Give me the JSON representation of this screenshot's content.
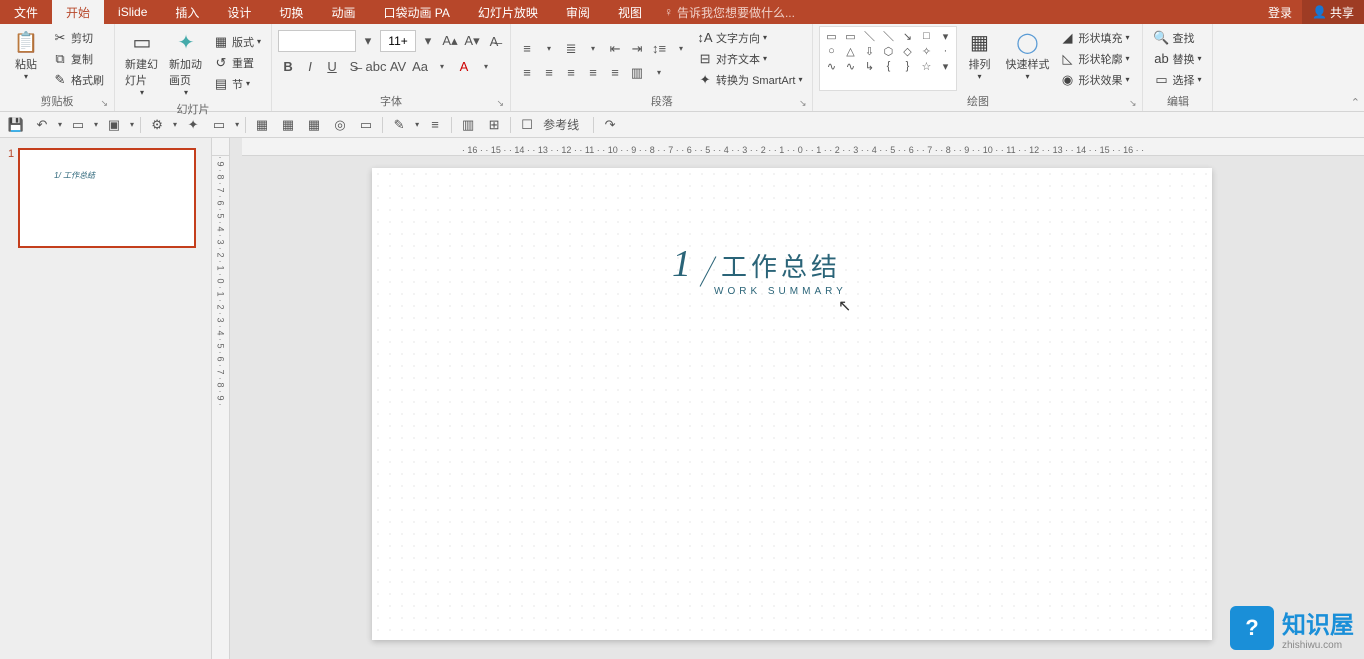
{
  "menu": {
    "file": "文件",
    "tabs": [
      "开始",
      "iSlide",
      "插入",
      "设计",
      "切换",
      "动画",
      "口袋动画 PA",
      "幻灯片放映",
      "审阅",
      "视图"
    ],
    "active": "开始",
    "tell_me_icon": "lightbulb-icon",
    "tell_me": "告诉我您想要做什么...",
    "login": "登录",
    "share": "共享"
  },
  "ribbon": {
    "clipboard": {
      "label": "剪贴板",
      "paste": "粘贴",
      "cut": "剪切",
      "copy": "复制",
      "format_painter": "格式刷"
    },
    "slides": {
      "label": "幻灯片",
      "new_slide": "新建幻灯片",
      "new_anim": "新加动画页",
      "layout": "版式",
      "reset": "重置",
      "section": "节"
    },
    "font": {
      "label": "字体",
      "name": "",
      "size": "11+"
    },
    "paragraph": {
      "label": "段落",
      "text_direction": "文字方向",
      "align_text": "对齐文本",
      "convert_smartart": "转换为 SmartArt"
    },
    "drawing": {
      "label": "绘图",
      "arrange": "排列",
      "quick_styles": "快速样式",
      "shape_fill": "形状填充",
      "shape_outline": "形状轮廓",
      "shape_effects": "形状效果"
    },
    "editing": {
      "label": "编辑",
      "find": "查找",
      "replace": "替换",
      "select": "选择"
    }
  },
  "qat": {
    "guides": "参考线"
  },
  "ruler": {
    "h": "· 16 · · 15 · · 14 · · 13 · · 12 · · 11 · · 10 · · 9 · · 8 · · 7 · · 6 · · 5 · · 4 · · 3 · · 2 · · 1 · · 0 · · 1 · · 2 · · 3 · · 4 · · 5 · · 6 · · 7 · · 8 · · 9 · · 10 · · 11 · · 12 · · 13 · · 14 · · 15 · · 16 · ·",
    "v": "· 9 · 8 · 7 · 6 · 5 · 4 · 3 · 2 · 1 · 0 · 1 · 2 · 3 · 4 · 5 · 6 · 7 · 8 · 9 ·"
  },
  "thumbs": {
    "items": [
      {
        "num": "1",
        "mark": "1/ 工作总结"
      }
    ]
  },
  "slide": {
    "number": "1",
    "title": "工作总结",
    "subtitle": "WORK  SUMMARY"
  },
  "watermark": {
    "badge": "?",
    "text": "知识屋",
    "sub": "zhishiwu.com"
  }
}
